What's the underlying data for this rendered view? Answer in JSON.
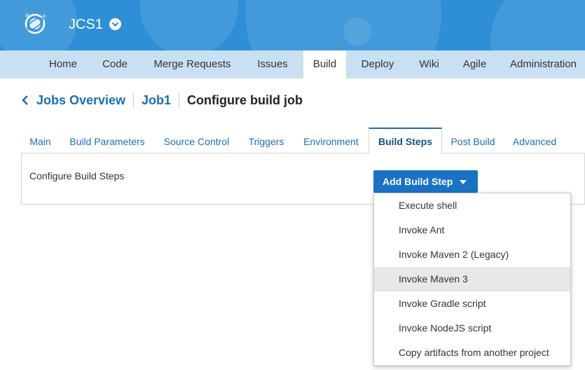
{
  "header": {
    "project_name": "JCS1",
    "colors": {
      "background": "#2e8fd6",
      "text": "#ffffff"
    }
  },
  "topnav": {
    "items": [
      {
        "label": "Home"
      },
      {
        "label": "Code"
      },
      {
        "label": "Merge Requests"
      },
      {
        "label": "Issues"
      },
      {
        "label": "Build",
        "active": true
      },
      {
        "label": "Deploy"
      },
      {
        "label": "Wiki"
      },
      {
        "label": "Agile"
      },
      {
        "label": "Administration"
      }
    ]
  },
  "breadcrumb": {
    "items": [
      "Jobs Overview",
      "Job1"
    ],
    "current": "Configure build job"
  },
  "subtabs": {
    "items": [
      {
        "label": "Main"
      },
      {
        "label": "Build Parameters"
      },
      {
        "label": "Source Control"
      },
      {
        "label": "Triggers"
      },
      {
        "label": "Environment"
      },
      {
        "label": "Build Steps",
        "active": true
      },
      {
        "label": "Post Build"
      },
      {
        "label": "Advanced"
      }
    ]
  },
  "panel": {
    "label": "Configure Build Steps",
    "add_button_label": "Add Build Step"
  },
  "menu": {
    "items": [
      {
        "label": "Execute shell"
      },
      {
        "label": "Invoke Ant"
      },
      {
        "label": "Invoke Maven 2 (Legacy)"
      },
      {
        "label": "Invoke Maven 3",
        "hover": true
      },
      {
        "label": "Invoke Gradle script"
      },
      {
        "label": "Invoke NodeJS script"
      },
      {
        "label": "Copy artifacts from another project"
      }
    ]
  },
  "icons": {
    "logo": "globe-logo-icon",
    "project_caret": "chevron-down-circle-icon",
    "back": "chevron-left-icon",
    "dropdown_caret": "caret-down-icon"
  }
}
